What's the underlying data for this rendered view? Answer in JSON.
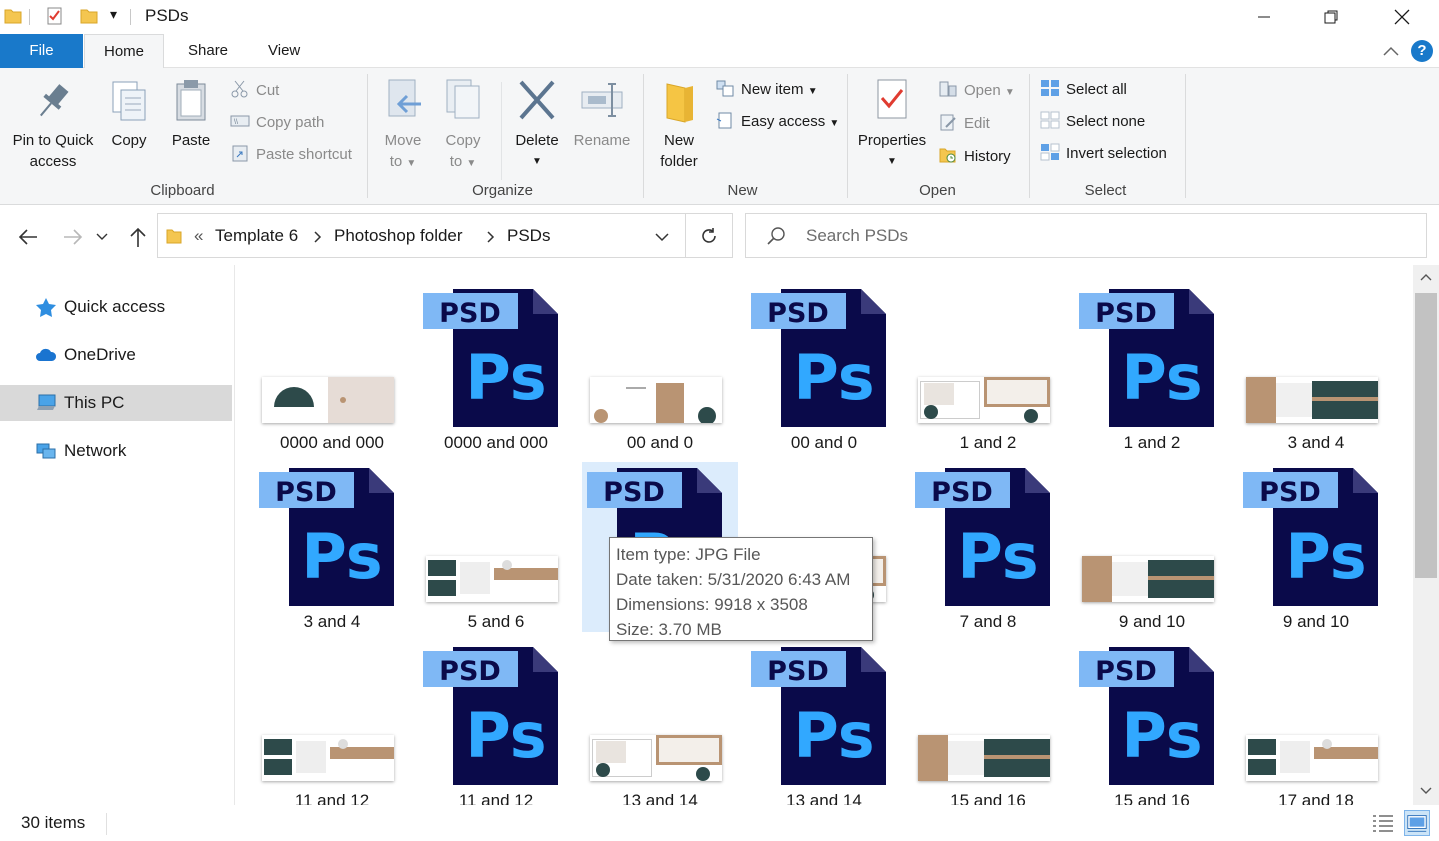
{
  "window": {
    "title": "PSDs"
  },
  "tabs": {
    "file": "File",
    "home": "Home",
    "share": "Share",
    "view": "View"
  },
  "ribbon": {
    "clipboard": {
      "label": "Clipboard",
      "pin": "Pin to Quick access",
      "pin_l1": "Pin to Quick",
      "pin_l2": "access",
      "copy": "Copy",
      "paste": "Paste",
      "cut": "Cut",
      "copy_path": "Copy path",
      "paste_shortcut": "Paste shortcut"
    },
    "organize": {
      "label": "Organize",
      "move_l1": "Move",
      "move_l2": "to",
      "copy_l1": "Copy",
      "copy_l2": "to",
      "delete": "Delete",
      "rename": "Rename"
    },
    "new": {
      "label": "New",
      "folder_l1": "New",
      "folder_l2": "folder",
      "new_item": "New item",
      "easy_access": "Easy access"
    },
    "open": {
      "label": "Open",
      "properties": "Properties",
      "open": "Open",
      "edit": "Edit",
      "history": "History"
    },
    "select": {
      "label": "Select",
      "select_all": "Select all",
      "select_none": "Select none",
      "invert": "Invert selection"
    }
  },
  "address": {
    "crumbs": [
      "Template 6",
      "Photoshop folder",
      "PSDs"
    ],
    "overflow": "«",
    "search_placeholder": "Search PSDs"
  },
  "nav": {
    "items": [
      {
        "label": "Quick access",
        "icon": "star-icon"
      },
      {
        "label": "OneDrive",
        "icon": "cloud-icon"
      },
      {
        "label": "This PC",
        "icon": "computer-icon",
        "selected": true
      },
      {
        "label": "Network",
        "icon": "network-icon"
      }
    ]
  },
  "files": [
    {
      "name": "0000 and 000",
      "kind": "jpg",
      "variant": "a"
    },
    {
      "name": "0000 and 000",
      "kind": "psd"
    },
    {
      "name": "00 and 0",
      "kind": "jpg",
      "variant": "b"
    },
    {
      "name": "00 and 0",
      "kind": "psd"
    },
    {
      "name": "1 and 2",
      "kind": "jpg",
      "variant": "c"
    },
    {
      "name": "1 and 2",
      "kind": "psd"
    },
    {
      "name": "3 and 4",
      "kind": "jpg",
      "variant": "d"
    },
    {
      "name": "3 and 4",
      "kind": "psd"
    },
    {
      "name": "5 and 6",
      "kind": "jpg",
      "variant": "e"
    },
    {
      "name": "",
      "kind": "psd",
      "selected": true
    },
    {
      "name": "",
      "kind": "jpg",
      "variant": "c"
    },
    {
      "name": "7 and 8",
      "kind": "psd"
    },
    {
      "name": "9 and 10",
      "kind": "jpg",
      "variant": "d"
    },
    {
      "name": "9 and 10",
      "kind": "psd"
    },
    {
      "name": "11 and 12",
      "kind": "jpg",
      "variant": "e"
    },
    {
      "name": "11 and 12",
      "kind": "psd"
    },
    {
      "name": "13 and 14",
      "kind": "jpg",
      "variant": "c"
    },
    {
      "name": "13 and 14",
      "kind": "psd"
    },
    {
      "name": "15 and 16",
      "kind": "jpg",
      "variant": "d"
    },
    {
      "name": "15 and 16",
      "kind": "psd"
    },
    {
      "name": "17 and 18",
      "kind": "jpg",
      "variant": "e"
    }
  ],
  "psd_badge": {
    "top": "PSD",
    "main": "Ps"
  },
  "tooltip": {
    "item_type": "Item type: JPG File",
    "date_taken": "Date taken: 5/31/2020 6:43 AM",
    "dimensions": "Dimensions: 9918 x 3508",
    "size": "Size: 3.70 MB"
  },
  "status": {
    "count": "30 items"
  },
  "colors": {
    "accent": "#1979ca",
    "psd_dark": "#0a0a4a",
    "psd_light": "#7fb8f5",
    "psd_text": "#31a8ff",
    "thumb_teal": "#2d4a4a",
    "thumb_tan": "#b99473",
    "selected_bg": "#dcecfc"
  }
}
